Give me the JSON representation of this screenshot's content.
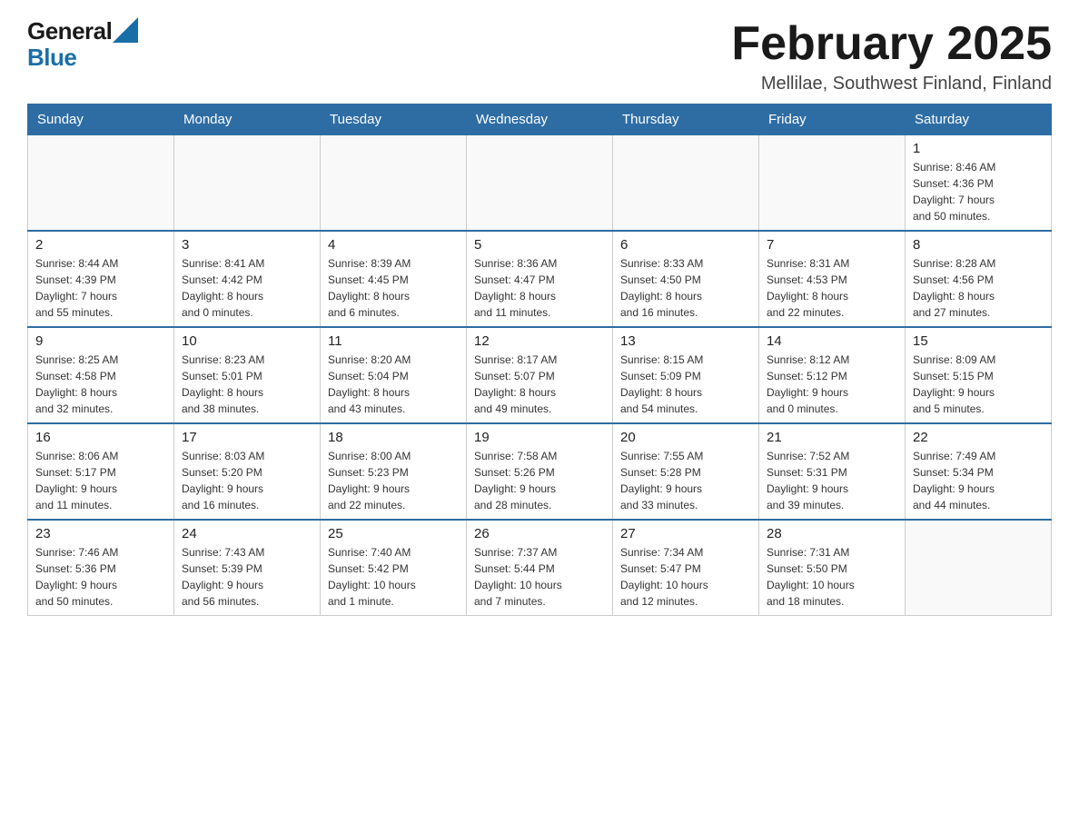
{
  "header": {
    "logo_general": "General",
    "logo_blue": "Blue",
    "title": "February 2025",
    "subtitle": "Mellilae, Southwest Finland, Finland"
  },
  "days_of_week": [
    "Sunday",
    "Monday",
    "Tuesday",
    "Wednesday",
    "Thursday",
    "Friday",
    "Saturday"
  ],
  "weeks": [
    [
      {
        "day": "",
        "info": ""
      },
      {
        "day": "",
        "info": ""
      },
      {
        "day": "",
        "info": ""
      },
      {
        "day": "",
        "info": ""
      },
      {
        "day": "",
        "info": ""
      },
      {
        "day": "",
        "info": ""
      },
      {
        "day": "1",
        "info": "Sunrise: 8:46 AM\nSunset: 4:36 PM\nDaylight: 7 hours\nand 50 minutes."
      }
    ],
    [
      {
        "day": "2",
        "info": "Sunrise: 8:44 AM\nSunset: 4:39 PM\nDaylight: 7 hours\nand 55 minutes."
      },
      {
        "day": "3",
        "info": "Sunrise: 8:41 AM\nSunset: 4:42 PM\nDaylight: 8 hours\nand 0 minutes."
      },
      {
        "day": "4",
        "info": "Sunrise: 8:39 AM\nSunset: 4:45 PM\nDaylight: 8 hours\nand 6 minutes."
      },
      {
        "day": "5",
        "info": "Sunrise: 8:36 AM\nSunset: 4:47 PM\nDaylight: 8 hours\nand 11 minutes."
      },
      {
        "day": "6",
        "info": "Sunrise: 8:33 AM\nSunset: 4:50 PM\nDaylight: 8 hours\nand 16 minutes."
      },
      {
        "day": "7",
        "info": "Sunrise: 8:31 AM\nSunset: 4:53 PM\nDaylight: 8 hours\nand 22 minutes."
      },
      {
        "day": "8",
        "info": "Sunrise: 8:28 AM\nSunset: 4:56 PM\nDaylight: 8 hours\nand 27 minutes."
      }
    ],
    [
      {
        "day": "9",
        "info": "Sunrise: 8:25 AM\nSunset: 4:58 PM\nDaylight: 8 hours\nand 32 minutes."
      },
      {
        "day": "10",
        "info": "Sunrise: 8:23 AM\nSunset: 5:01 PM\nDaylight: 8 hours\nand 38 minutes."
      },
      {
        "day": "11",
        "info": "Sunrise: 8:20 AM\nSunset: 5:04 PM\nDaylight: 8 hours\nand 43 minutes."
      },
      {
        "day": "12",
        "info": "Sunrise: 8:17 AM\nSunset: 5:07 PM\nDaylight: 8 hours\nand 49 minutes."
      },
      {
        "day": "13",
        "info": "Sunrise: 8:15 AM\nSunset: 5:09 PM\nDaylight: 8 hours\nand 54 minutes."
      },
      {
        "day": "14",
        "info": "Sunrise: 8:12 AM\nSunset: 5:12 PM\nDaylight: 9 hours\nand 0 minutes."
      },
      {
        "day": "15",
        "info": "Sunrise: 8:09 AM\nSunset: 5:15 PM\nDaylight: 9 hours\nand 5 minutes."
      }
    ],
    [
      {
        "day": "16",
        "info": "Sunrise: 8:06 AM\nSunset: 5:17 PM\nDaylight: 9 hours\nand 11 minutes."
      },
      {
        "day": "17",
        "info": "Sunrise: 8:03 AM\nSunset: 5:20 PM\nDaylight: 9 hours\nand 16 minutes."
      },
      {
        "day": "18",
        "info": "Sunrise: 8:00 AM\nSunset: 5:23 PM\nDaylight: 9 hours\nand 22 minutes."
      },
      {
        "day": "19",
        "info": "Sunrise: 7:58 AM\nSunset: 5:26 PM\nDaylight: 9 hours\nand 28 minutes."
      },
      {
        "day": "20",
        "info": "Sunrise: 7:55 AM\nSunset: 5:28 PM\nDaylight: 9 hours\nand 33 minutes."
      },
      {
        "day": "21",
        "info": "Sunrise: 7:52 AM\nSunset: 5:31 PM\nDaylight: 9 hours\nand 39 minutes."
      },
      {
        "day": "22",
        "info": "Sunrise: 7:49 AM\nSunset: 5:34 PM\nDaylight: 9 hours\nand 44 minutes."
      }
    ],
    [
      {
        "day": "23",
        "info": "Sunrise: 7:46 AM\nSunset: 5:36 PM\nDaylight: 9 hours\nand 50 minutes."
      },
      {
        "day": "24",
        "info": "Sunrise: 7:43 AM\nSunset: 5:39 PM\nDaylight: 9 hours\nand 56 minutes."
      },
      {
        "day": "25",
        "info": "Sunrise: 7:40 AM\nSunset: 5:42 PM\nDaylight: 10 hours\nand 1 minute."
      },
      {
        "day": "26",
        "info": "Sunrise: 7:37 AM\nSunset: 5:44 PM\nDaylight: 10 hours\nand 7 minutes."
      },
      {
        "day": "27",
        "info": "Sunrise: 7:34 AM\nSunset: 5:47 PM\nDaylight: 10 hours\nand 12 minutes."
      },
      {
        "day": "28",
        "info": "Sunrise: 7:31 AM\nSunset: 5:50 PM\nDaylight: 10 hours\nand 18 minutes."
      },
      {
        "day": "",
        "info": ""
      }
    ]
  ]
}
